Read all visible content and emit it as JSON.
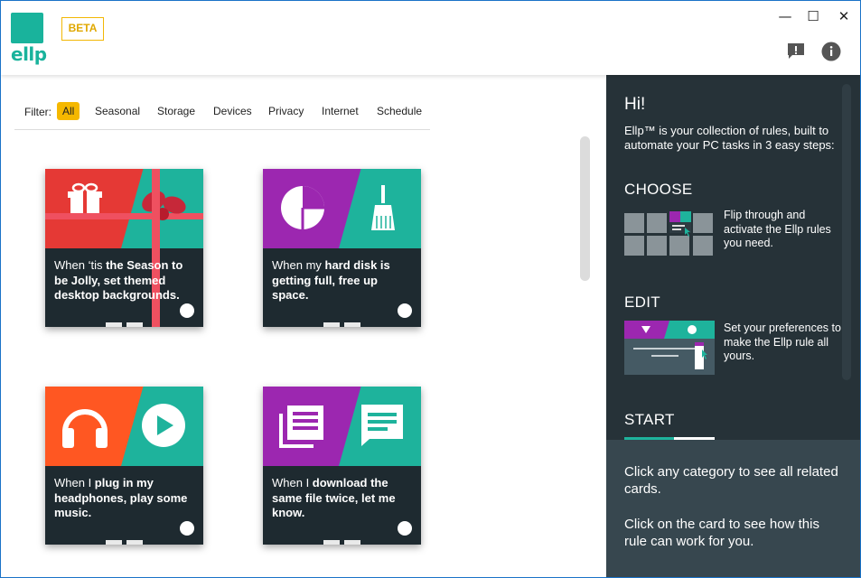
{
  "app": {
    "logo_text": "ellp",
    "beta_label": "BETA"
  },
  "window_controls": {
    "minimize": "—",
    "maximize": "☐",
    "close": "✕"
  },
  "header_icons": [
    "feedback-icon",
    "info-icon"
  ],
  "filter": {
    "label": "Filter:",
    "chips": [
      "All",
      "Seasonal",
      "Storage",
      "Devices",
      "Privacy",
      "Internet",
      "Schedule"
    ],
    "active": "All"
  },
  "cards": [
    {
      "text_pre": "When ‘tis ",
      "text_bold": "the Season to be Jolly, set themed desktop backgrounds.",
      "icons": [
        "gift-icon",
        "bow-icon"
      ],
      "colors": [
        "#e53935",
        "#1eb39c"
      ]
    },
    {
      "text_pre": "When my ",
      "text_bold": "hard disk is getting full, free up space.",
      "icons": [
        "pie-chart-icon",
        "broom-icon"
      ],
      "colors": [
        "#9c27b0",
        "#1eb39c"
      ]
    },
    {
      "text_pre": "When I ",
      "text_bold": "plug in my headphones, play some music.",
      "icons": [
        "headphones-icon",
        "play-icon"
      ],
      "colors": [
        "#ff5722",
        "#1eb39c"
      ]
    },
    {
      "text_pre": "When I ",
      "text_bold": "download the same file twice, let me know.",
      "icons": [
        "document-list-icon",
        "chat-icon"
      ],
      "colors": [
        "#9c27b0",
        "#1eb39c"
      ]
    }
  ],
  "panel": {
    "greeting": "Hi!",
    "intro": "Ellp™ is your collection of rules, built to automate your PC tasks in 3 easy steps:",
    "steps": [
      {
        "title": "CHOOSE",
        "desc": "Flip through and activate the Ellp rules you need."
      },
      {
        "title": "EDIT",
        "desc": "Set your preferences to make the Ellp rule all yours."
      },
      {
        "title": "START",
        "desc": ""
      }
    ]
  },
  "help": {
    "line1": "Click any category to see all related cards.",
    "line2": "Click on the card to see how this rule can work for you."
  },
  "colors": {
    "brand": "#19b39c",
    "beta": "#f5b800",
    "panel": "#263238",
    "help": "#37474f"
  }
}
